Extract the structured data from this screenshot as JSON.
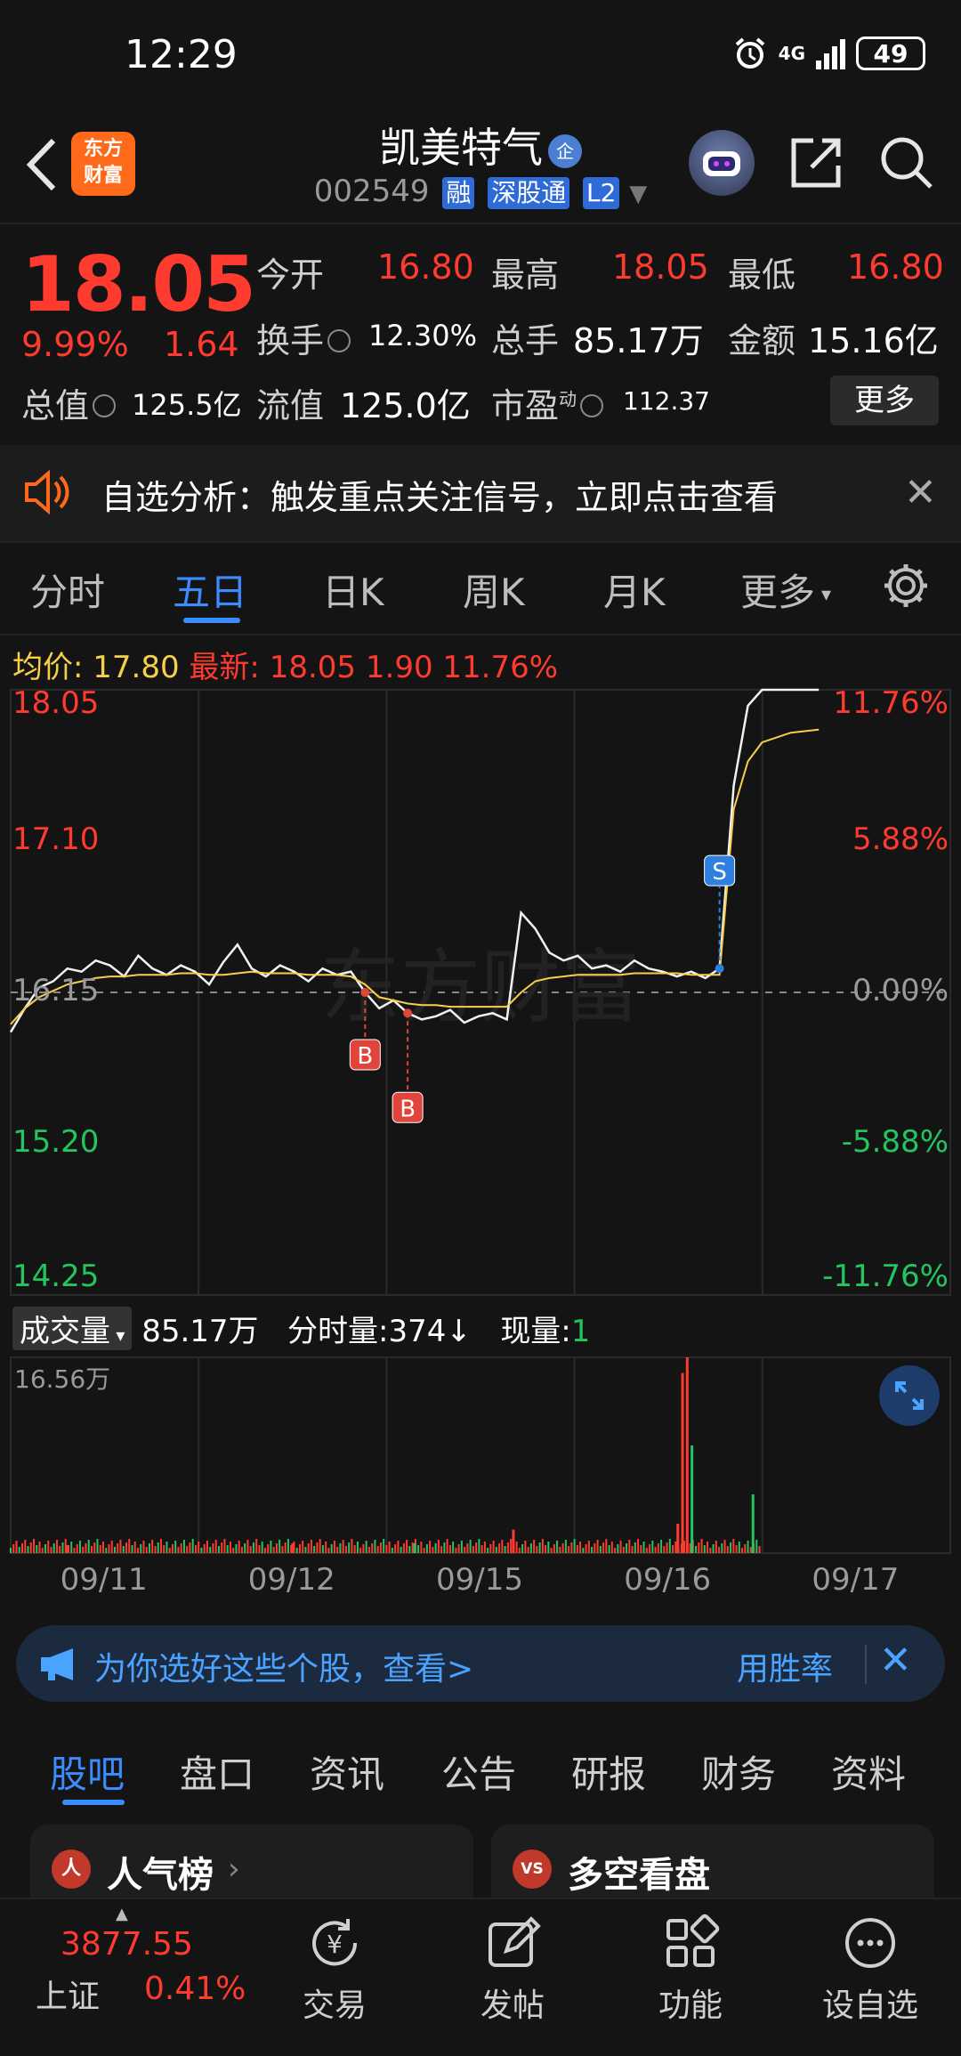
{
  "status": {
    "time": "12:29",
    "network": "4G",
    "battery": "49"
  },
  "header": {
    "logo": [
      "东方",
      "财富"
    ],
    "title": "凯美特气",
    "title_badge": "企",
    "code": "002549",
    "tags": [
      "融",
      "深股通",
      "L2"
    ]
  },
  "quote": {
    "price": "18.05",
    "pct": "9.99%",
    "chg": "1.64",
    "open_label": "今开",
    "open": "16.80",
    "high_label": "最高",
    "high": "18.05",
    "low_label": "最低",
    "low": "16.80",
    "turnover_label": "换手",
    "turnover": "12.30%",
    "volume_label": "总手",
    "volume": "85.17万",
    "amount_label": "金额",
    "amount": "15.16亿",
    "mktcap_label": "总值",
    "mktcap": "125.5亿",
    "float_label": "流值",
    "float": "125.0亿",
    "pe_label": "市盈",
    "pe_sup": "动",
    "pe": "112.37",
    "more": "更多"
  },
  "alert": {
    "text": "自选分析：触发重点关注信号，立即点击查看",
    "close": "✕"
  },
  "tabs": {
    "items": [
      "分时",
      "五日",
      "日K",
      "周K",
      "月K",
      "更多"
    ],
    "active": 1
  },
  "info_line": {
    "avg_label": "均价:",
    "avg": "17.80",
    "latest_label": "最新:",
    "latest": "18.05",
    "chg": "1.90",
    "pct": "11.76%"
  },
  "chart_data": {
    "type": "line",
    "title": "",
    "y_left": [
      "18.05",
      "17.10",
      "16.15",
      "15.20",
      "14.25"
    ],
    "y_right": [
      "11.76%",
      "5.88%",
      "0.00%",
      "-5.88%",
      "-11.76%"
    ],
    "ylim": [
      14.25,
      18.05
    ],
    "prev_close": 16.15,
    "x_labels": [
      "09/11",
      "09/12",
      "09/15",
      "09/16",
      "09/17"
    ],
    "series": [
      {
        "values": [
          15.9,
          16.05,
          16.18,
          16.22,
          16.3,
          16.28,
          16.35,
          16.32,
          16.25,
          16.38,
          16.3,
          16.26,
          16.32,
          16.28,
          16.2,
          16.34,
          16.45,
          16.3,
          16.25,
          16.32,
          16.28,
          16.22,
          16.3,
          16.26,
          16.28,
          16.15,
          16.05,
          16.1,
          16.02,
          15.98,
          16.0,
          16.04,
          15.96,
          16.0,
          16.02,
          15.98,
          16.65,
          16.55,
          16.4,
          16.35,
          16.38,
          16.3,
          16.32,
          16.28,
          16.35,
          16.3,
          16.28,
          16.25,
          16.28,
          16.24,
          16.3,
          17.45,
          17.95,
          18.05,
          18.05,
          18.05,
          18.05,
          18.05
        ]
      },
      {
        "values": [
          15.95,
          16.05,
          16.12,
          16.16,
          16.2,
          16.22,
          16.24,
          16.25,
          16.25,
          16.26,
          16.26,
          16.26,
          16.27,
          16.27,
          16.26,
          16.26,
          16.27,
          16.28,
          16.27,
          16.27,
          16.27,
          16.26,
          16.26,
          16.26,
          16.25,
          16.2,
          16.12,
          16.1,
          16.08,
          16.07,
          16.07,
          16.06,
          16.06,
          16.06,
          16.06,
          16.06,
          16.15,
          16.22,
          16.24,
          16.25,
          16.26,
          16.26,
          16.26,
          16.26,
          16.27,
          16.27,
          16.27,
          16.27,
          16.26,
          16.26,
          16.26,
          17.3,
          17.6,
          17.72,
          17.75,
          17.78,
          17.79,
          17.8
        ]
      }
    ],
    "markers": [
      "B",
      "B",
      "S"
    ]
  },
  "volume": {
    "selector": "成交量",
    "total": "85.17万",
    "tick_label": "分时量:",
    "tick": "374",
    "now_label": "现量:",
    "now": "1",
    "max": "16.56万"
  },
  "banner": {
    "text": "为你选好这些个股，查看>",
    "right": "用胜率",
    "close": "✕"
  },
  "sub_tabs": {
    "items": [
      "股吧",
      "盘口",
      "资讯",
      "公告",
      "研报",
      "财务",
      "资料"
    ],
    "active": 0
  },
  "cards": [
    {
      "icon": "人",
      "title": "人气榜"
    },
    {
      "icon": "VS",
      "title": "多空看盘"
    }
  ],
  "nav": {
    "index_value": "3877.55",
    "index_name": "上证",
    "index_pct": "0.41%",
    "items": [
      "交易",
      "发帖",
      "功能",
      "设自选"
    ]
  },
  "colors": {
    "up": "#ff3b30",
    "down": "#22c55e",
    "accent": "#3b8cff",
    "avg": "#f7d04a"
  }
}
